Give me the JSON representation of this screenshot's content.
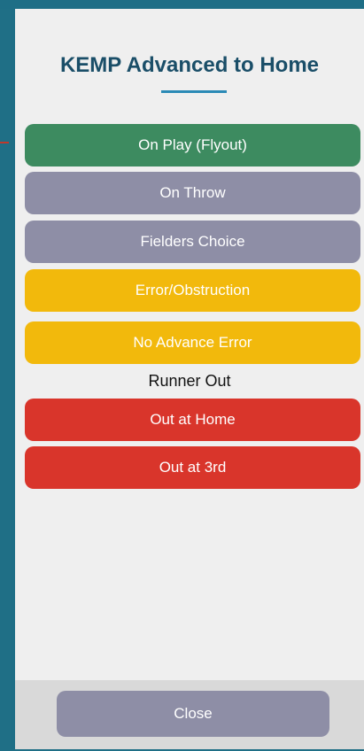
{
  "modal": {
    "title": "KEMP Advanced to Home",
    "buttons": [
      {
        "label": "On Play (Flyout)",
        "color": "#3d8b60"
      },
      {
        "label": "On Throw",
        "color": "#8e8ea6"
      },
      {
        "label": "Fielders Choice",
        "color": "#8e8ea6"
      },
      {
        "label": "Error/Obstruction",
        "color": "#f2b90c"
      },
      {
        "label": "No Advance Error",
        "color": "#f2b90c"
      }
    ],
    "runner_out_label": "Runner Out",
    "out_buttons": [
      {
        "label": "Out at Home",
        "color": "#d9352b"
      },
      {
        "label": "Out at 3rd",
        "color": "#d9352b"
      }
    ],
    "close_label": "Close"
  },
  "colors": {
    "frame": "#1e6e86",
    "title": "#1a4e68",
    "underline": "#2b8ab6",
    "background": "#efefef",
    "footer": "#d9d9d9"
  }
}
